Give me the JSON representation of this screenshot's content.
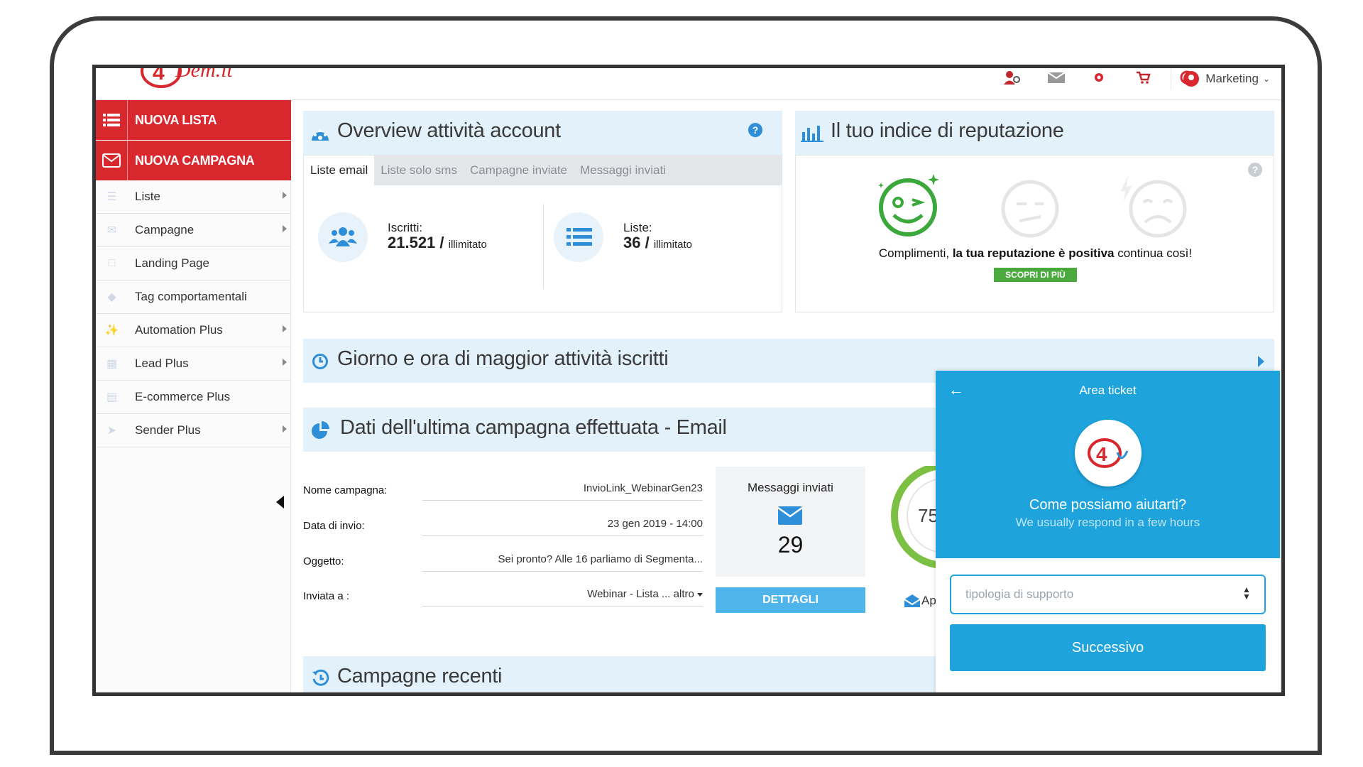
{
  "topbar": {
    "logo_text": "Dem.it",
    "profile_label": "Marketing",
    "icons": [
      "user-search-icon",
      "mail-icon",
      "gear-icon",
      "cart-icon",
      "lifebuoy-icon"
    ]
  },
  "sidebar": {
    "new_list": "NUOVA LISTA",
    "new_campaign": "NUOVA CAMPAGNA",
    "items": [
      {
        "label": "Liste",
        "icon": "list-icon",
        "submenu": true
      },
      {
        "label": "Campagne",
        "icon": "envelope-icon",
        "submenu": true
      },
      {
        "label": "Landing Page",
        "icon": "page-icon",
        "submenu": false
      },
      {
        "label": "Tag comportamentali",
        "icon": "tag-icon",
        "submenu": false
      },
      {
        "label": "Automation Plus",
        "icon": "magic-icon",
        "submenu": true
      },
      {
        "label": "Lead Plus",
        "icon": "form-icon",
        "submenu": true
      },
      {
        "label": "E-commerce Plus",
        "icon": "cart-icon",
        "submenu": false
      },
      {
        "label": "Sender Plus",
        "icon": "send-icon",
        "submenu": true
      }
    ]
  },
  "overview": {
    "title": "Overview attività account",
    "tabs": [
      "Liste email",
      "Liste solo sms",
      "Campagne inviate",
      "Messaggi inviati"
    ],
    "active_tab": 0,
    "subscribers_label": "Iscritti:",
    "subscribers_value": "21.521 /",
    "subscribers_limit": "illimitato",
    "lists_label": "Liste:",
    "lists_value": "36 /",
    "lists_limit": "illimitato"
  },
  "reputation": {
    "title": "Il tuo indice di reputazione",
    "message_pre": "Complimenti,",
    "message_bold": "la tua reputazione è positiva",
    "message_post": "continua così!",
    "cta": "SCOPRI DI PIÙ",
    "status": "positive",
    "accent_color": "#3aa83a"
  },
  "activity": {
    "title": "Giorno e ora di maggior attività iscritti"
  },
  "last_campaign": {
    "title": "Dati dell'ultima campagna effettuata - Email",
    "rows": [
      {
        "label": "Nome campagna:",
        "value": "InvioLink_WebinarGen23"
      },
      {
        "label": "Data di invio:",
        "value": "23 gen 2019 - 14:00"
      },
      {
        "label": "Oggetto:",
        "value": "Sei pronto? Alle 16 parliamo di Segmenta..."
      },
      {
        "label": "Inviata a :",
        "value": "Webinar - Lista ... altro"
      }
    ],
    "sent_title": "Messaggi inviati",
    "sent_count": "29",
    "details_button": "DETTAGLI",
    "gauge_value": "75",
    "gauge_caption": "Ap"
  },
  "recent": {
    "title": "Campagne recenti"
  },
  "ticket": {
    "title": "Area ticket",
    "headline": "Come possiamo aiutarti?",
    "subline": "We usually respond in a few hours",
    "select_placeholder": "tipologia di supporto",
    "next_button": "Successivo"
  },
  "colors": {
    "brand_red": "#d9272e",
    "accent_blue": "#1ea3dd",
    "panel_bg": "#e3f1fa"
  }
}
